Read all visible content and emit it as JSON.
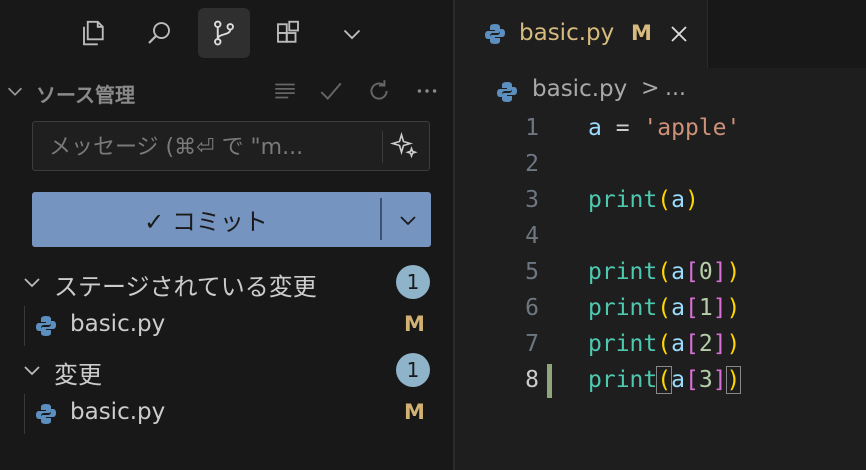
{
  "activity_bar": {
    "items": [
      {
        "icon": "files-icon"
      },
      {
        "icon": "search-icon"
      },
      {
        "icon": "source-control-icon",
        "active": true
      },
      {
        "icon": "extensions-icon"
      },
      {
        "icon": "chevron-down-icon"
      }
    ]
  },
  "scm": {
    "title": "ソース管理",
    "message_placeholder": "メッセージ (⌘⏎ で \"m...",
    "commit_label": "✓ コミット",
    "staged_group": {
      "label": "ステージされている変更",
      "count": "1"
    },
    "staged_files": [
      {
        "name": "basic.py",
        "status": "M"
      }
    ],
    "changes_group": {
      "label": "変更",
      "count": "1"
    },
    "changes_files": [
      {
        "name": "basic.py",
        "status": "M"
      }
    ]
  },
  "editor": {
    "tab": {
      "name": "basic.py",
      "modified": "M"
    },
    "breadcrumb": {
      "file": "basic.py",
      "separator": ">",
      "rest": "..."
    },
    "current_line": 8,
    "lines": [
      {
        "n": "1"
      },
      {
        "n": "2"
      },
      {
        "n": "3"
      },
      {
        "n": "4"
      },
      {
        "n": "5"
      },
      {
        "n": "6"
      },
      {
        "n": "7"
      },
      {
        "n": "8"
      }
    ],
    "code": {
      "l1": {
        "var": "a",
        "eq": " = ",
        "str": "'apple'"
      },
      "l3": {
        "fn": "print",
        "arg": "a"
      },
      "l5": {
        "fn": "print",
        "arg": "a",
        "idx": "0"
      },
      "l6": {
        "fn": "print",
        "arg": "a",
        "idx": "1"
      },
      "l7": {
        "fn": "print",
        "arg": "a",
        "idx": "2"
      },
      "l8": {
        "fn": "print",
        "arg": "a",
        "idx": "3"
      }
    }
  },
  "colors": {
    "accent_button": "#7694c0",
    "modified": "#d2b173",
    "badge": "#8fb3c8"
  }
}
